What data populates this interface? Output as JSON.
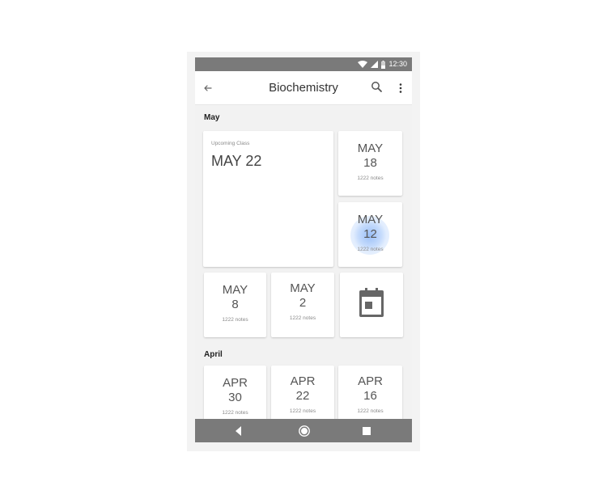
{
  "status_bar": {
    "time": "12:30"
  },
  "app_bar": {
    "title": "Biochemistry"
  },
  "sections": [
    {
      "title": "May",
      "upcoming": {
        "label": "Upcoming Class",
        "date": "MAY 22"
      },
      "cards": [
        {
          "month": "MAY",
          "day": "18",
          "notes": "1222 notes"
        },
        {
          "month": "MAY",
          "day": "12",
          "notes": "1222 notes"
        },
        {
          "month": "MAY",
          "day": "8",
          "notes": "1222 notes"
        },
        {
          "month": "MAY",
          "day": "2",
          "notes": "1222 notes"
        }
      ]
    },
    {
      "title": "April",
      "cards": [
        {
          "month": "APR",
          "day": "30",
          "notes": "1222 notes"
        },
        {
          "month": "APR",
          "day": "22",
          "notes": "1222 notes"
        },
        {
          "month": "APR",
          "day": "16",
          "notes": "1222 notes"
        }
      ]
    }
  ],
  "colors": {
    "status_bar": "#7a7a7a",
    "nav_bar": "#7a7a7a",
    "background": "#f2f2f2",
    "ripple": "#7aaaf5"
  },
  "icons": {
    "back": "arrow-back-icon",
    "search": "search-icon",
    "more": "more-vert-icon",
    "calendar": "calendar-icon",
    "nav_back": "nav-back-icon",
    "nav_home": "nav-home-icon",
    "nav_recents": "nav-recents-icon"
  }
}
